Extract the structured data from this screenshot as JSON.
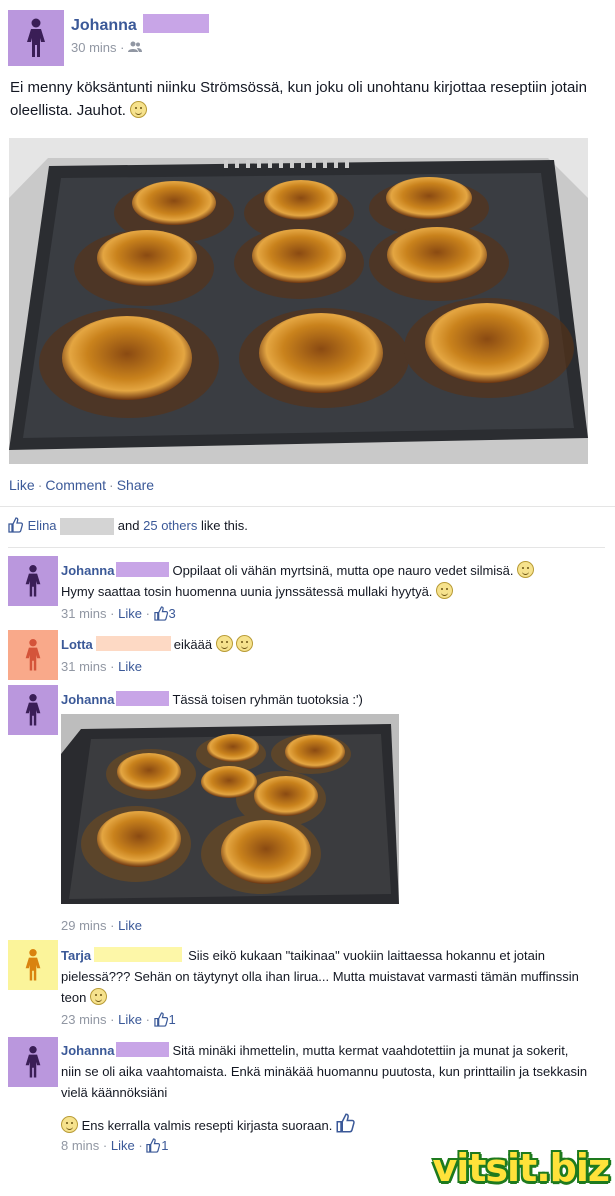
{
  "post": {
    "author": "Johanna",
    "time": "30 mins",
    "text": "Ei menny köksäntunti niinku Strömsössä, kun joku oli unohtanu kirjottaa reseptiin jotain oleellista. Jauhot.",
    "actions": {
      "like": "Like",
      "comment": "Comment",
      "share": "Share"
    },
    "likes": {
      "first": "Elina",
      "and": "and",
      "count": "25 others",
      "suffix": "like this."
    }
  },
  "comments": [
    {
      "author": "Johanna",
      "text": "Oppilaat oli vähän myrtsinä, mutta ope nauro vedet silmisä.",
      "text2": "Hymy saattaa tosin huomenna uunia jynssätessä mullaki hyytyä.",
      "time": "31 mins",
      "like": "Like",
      "likes": "3"
    },
    {
      "author": "Lotta",
      "text": "eikäää",
      "time": "31 mins",
      "like": "Like"
    },
    {
      "author": "Johanna",
      "text": "Tässä toisen ryhmän tuotoksia :')",
      "time": "29 mins",
      "like": "Like"
    },
    {
      "author": "Tarja",
      "text": "Siis eikö kukaan \"taikinaa\" vuokiin laittaessa hokannu et jotain pielessä??? Sehän on täytynyt olla ihan lirua... Mutta muistavat varmasti tämän muffinssin teon",
      "time": "23 mins",
      "like": "Like",
      "likes": "1"
    },
    {
      "author": "Johanna",
      "text": "Sitä minäki ihmettelin, mutta kermat vaahdotettiin ja munat ja sokerit, niin se oli aika vaahtomaista. Enkä minäkää huomannu puutosta, kun printtailin ja tsekkasin vielä käännöksiäni",
      "text2": "Ens kerralla valmis resepti kirjasta suoraan.",
      "time": "8 mins",
      "like": "Like",
      "likes": "1"
    }
  ],
  "watermark": "vitsit.biz",
  "colors": {
    "link": "#3b5998",
    "meta": "#9197a3",
    "avatar_purple": "#ba97dd",
    "avatar_orange": "#f9a98a",
    "avatar_yellow": "#fbf49a"
  }
}
